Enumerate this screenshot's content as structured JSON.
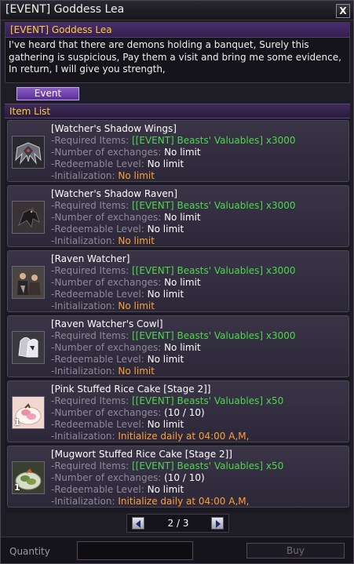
{
  "window": {
    "title": "[EVENT] Goddess Lea",
    "close_label": "X"
  },
  "npc": {
    "name": "[EVENT] Goddess Lea",
    "description": "I've heard that there are demons holding a banquet, Surely this gathering is suspicious, Pay them a visit and bring me some evidence, In return, I will give you strength,"
  },
  "tabs": [
    {
      "label": "Event",
      "active": true
    }
  ],
  "list_header": "Item List",
  "field_labels": {
    "required": "-Required Items:",
    "exchanges": "-Number of exchanges:",
    "redeemable": "-Redeemable Level:",
    "initialization": "-Initialization:"
  },
  "items": [
    {
      "name": "[Watcher's Shadow Wings]",
      "required": "[[EVENT] Beasts' Valuables] x3000",
      "exchanges": "No limit",
      "redeemable": "No limit",
      "initialization": "No limit",
      "icon": "wings-icon",
      "count": ""
    },
    {
      "name": "[Watcher's Shadow Raven]",
      "required": "[[EVENT] Beasts' Valuables] x3000",
      "exchanges": "No limit",
      "redeemable": "No limit",
      "initialization": "No limit",
      "icon": "raven-icon",
      "count": ""
    },
    {
      "name": "[Raven Watcher]",
      "required": "[[EVENT] Beasts' Valuables] x3000",
      "exchanges": "No limit",
      "redeemable": "No limit",
      "initialization": "No limit",
      "icon": "costume-icon",
      "count": ""
    },
    {
      "name": "[Raven Watcher's Cowl]",
      "required": "[[EVENT] Beasts' Valuables] x3000",
      "exchanges": "No limit",
      "redeemable": "No limit",
      "initialization": "No limit",
      "icon": "cowl-icon",
      "count": ""
    },
    {
      "name": "[Pink Stuffed Rice Cake [Stage 2]]",
      "required": "[[EVENT] Beasts' Valuables] x50",
      "exchanges": "(10 / 10)",
      "redeemable": "No limit",
      "initialization": "Initialize daily at 04:00 A,M,",
      "icon": "pink-rice-cake-icon",
      "count": "1"
    },
    {
      "name": "[Mugwort Stuffed Rice Cake [Stage 2]]",
      "required": "[[EVENT] Beasts' Valuables] x50",
      "exchanges": "(10 / 10)",
      "redeemable": "No limit",
      "initialization": "Initialize daily at 04:00 A,M,",
      "icon": "mugwort-rice-cake-icon",
      "count": "1"
    }
  ],
  "pager": {
    "text": "2 / 3"
  },
  "bottom": {
    "quantity_label": "Quantity",
    "quantity_value": "",
    "buy_label": "Buy"
  },
  "colors": {
    "accent_purple": "#6b3fa6",
    "header_gold": "#ffcc33",
    "required_green": "#4cd84c",
    "init_orange": "#ff9f3a"
  }
}
